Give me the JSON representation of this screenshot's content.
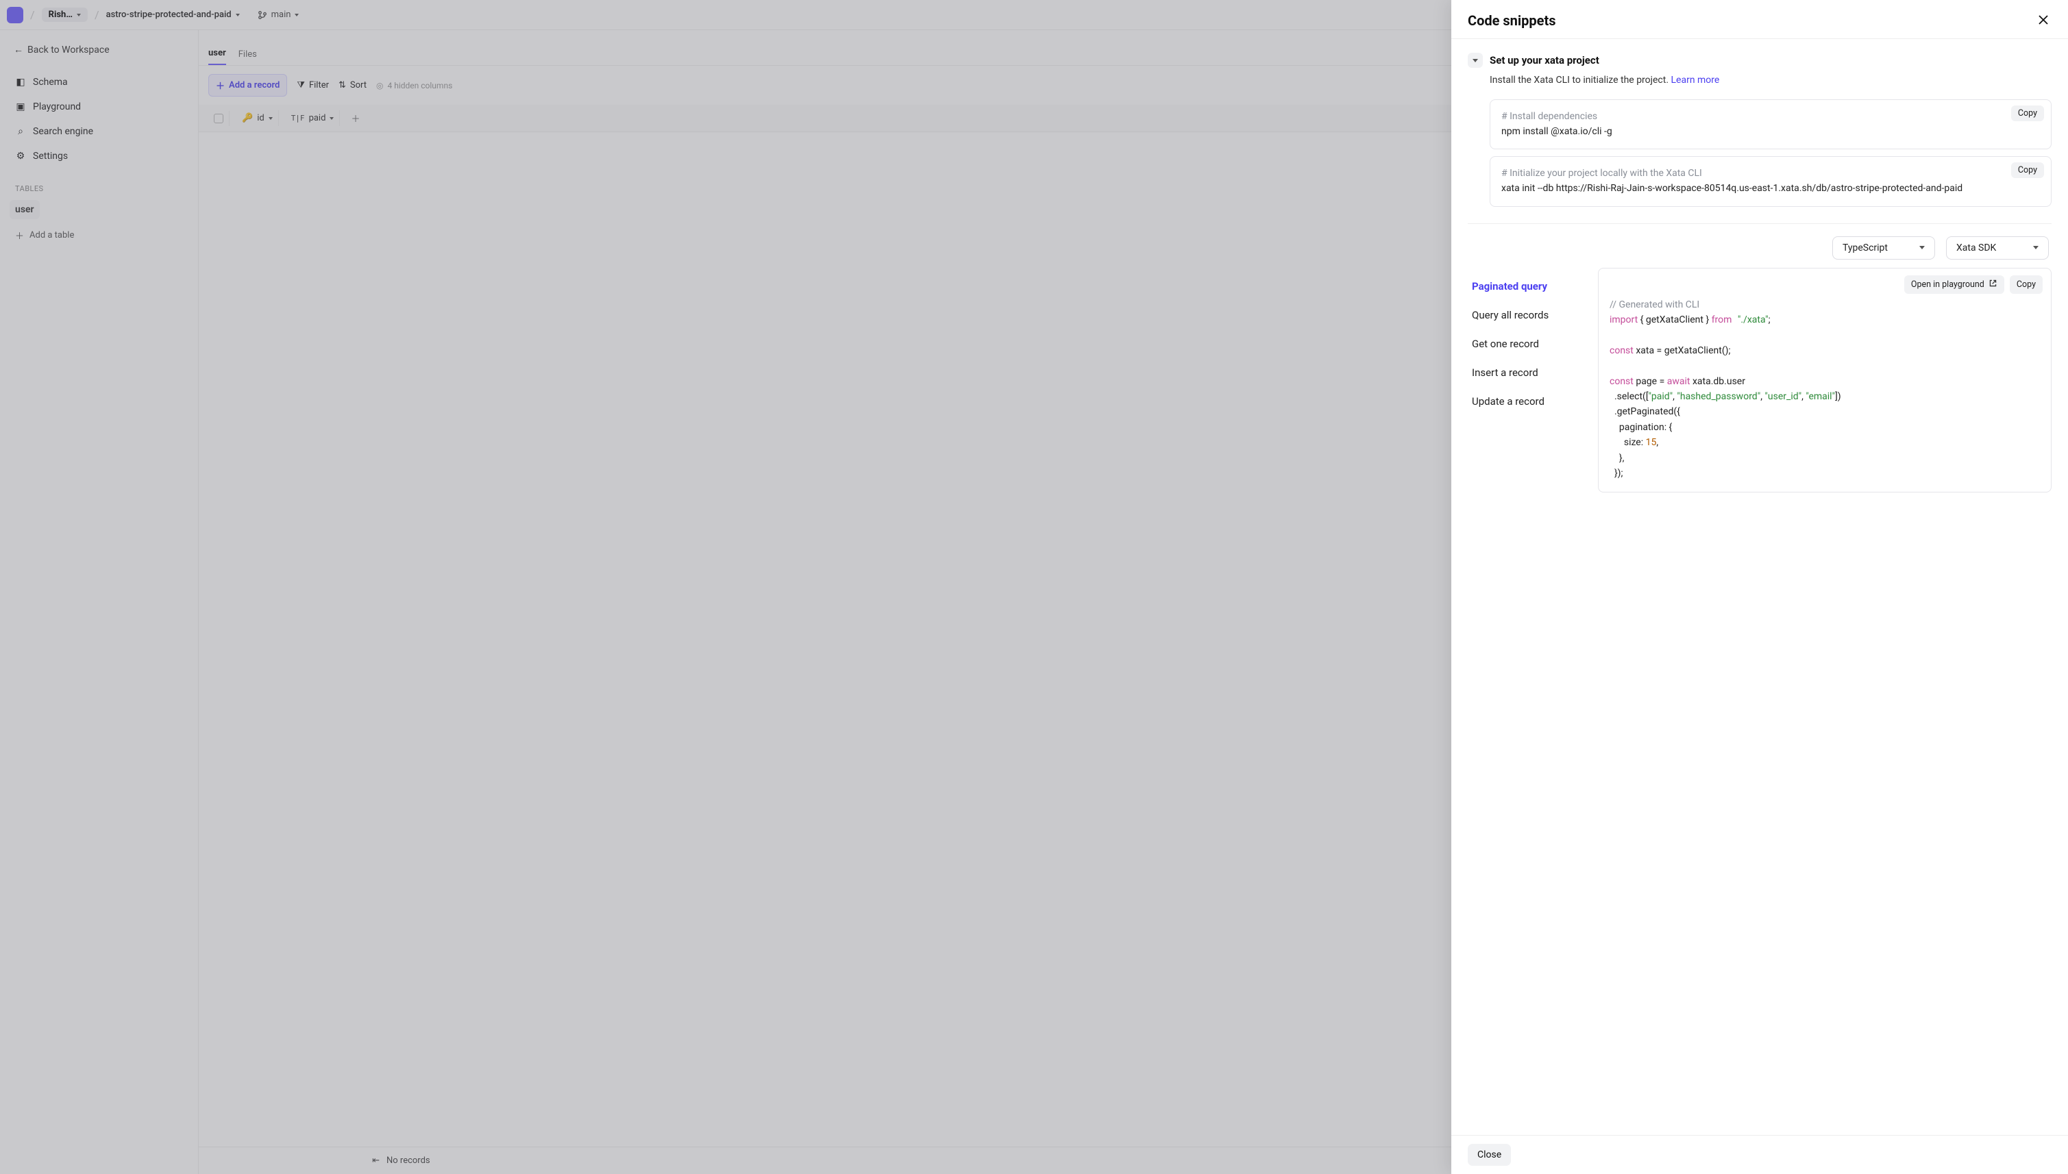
{
  "topbar": {
    "workspace_short": "Rish…",
    "db_name": "astro-stripe-protected-and-paid",
    "branch": "main"
  },
  "sidebar": {
    "back": "Back to Workspace",
    "nav": {
      "schema": "Schema",
      "playground": "Playground",
      "search": "Search engine",
      "settings": "Settings"
    },
    "section": "Tables",
    "table": "user",
    "add": "Add a table"
  },
  "main": {
    "tabs": {
      "active": "user",
      "other": "Files"
    },
    "toolbar": {
      "add_record": "Add a record",
      "filter": "Filter",
      "sort": "Sort",
      "hidden": "4 hidden columns"
    },
    "cols": {
      "id": "id",
      "paid": "paid"
    },
    "footer": {
      "records": "No records"
    }
  },
  "panel": {
    "title": "Code snippets",
    "section1": {
      "title": "Set up your xata project",
      "desc": "Install the Xata CLI to initialize the project. ",
      "learn": "Learn more",
      "block1_comment": "# Install dependencies",
      "block1_cmd": "npm install @xata.io/cli -g",
      "block2_comment": "# Initialize your project locally with the Xata CLI",
      "block2_cmd": "xata init --db https://Rishi-Raj-Jain-s-workspace-80514q.us-east-1.xata.sh/db/astro-stripe-protected-and-paid",
      "copy": "Copy"
    },
    "selects": {
      "lang": "TypeScript",
      "sdk": "Xata SDK"
    },
    "query_nav": {
      "paginated": "Paginated query",
      "all": "Query all records",
      "one": "Get one record",
      "insert": "Insert a record",
      "update": "Update a record"
    },
    "code_actions": {
      "open": "Open in playground",
      "copy": "Copy"
    },
    "code": {
      "c1": "// Generated with CLI",
      "kw_import": "import",
      "import_mid": " { getXataClient } ",
      "kw_from": "from",
      "str_xata": "\"./xata\"",
      "semi": ";",
      "kw_const1": "const",
      "l_const1": " xata = getXataClient();",
      "kw_const2": "const",
      "l_const2a": " page = ",
      "kw_await": "await",
      "l_const2b": " xata.db.user",
      "l_select_a": "  .select([",
      "s_paid": "\"paid\"",
      "comma": ", ",
      "s_hash": "\"hashed_password\"",
      "s_uid": "\"user_id\"",
      "s_email": "\"email\"",
      "l_select_b": "])",
      "l_getp": "  .getPaginated({",
      "l_pag_a": "    ",
      "k_pagination": "pagination",
      "l_pag_b": ": {",
      "l_size_a": "      ",
      "k_size": "size",
      "l_size_b": ": ",
      "n_15": "15",
      "l_size_c": ",",
      "l_close1": "    },",
      "l_close2": "  });"
    },
    "close": "Close"
  }
}
